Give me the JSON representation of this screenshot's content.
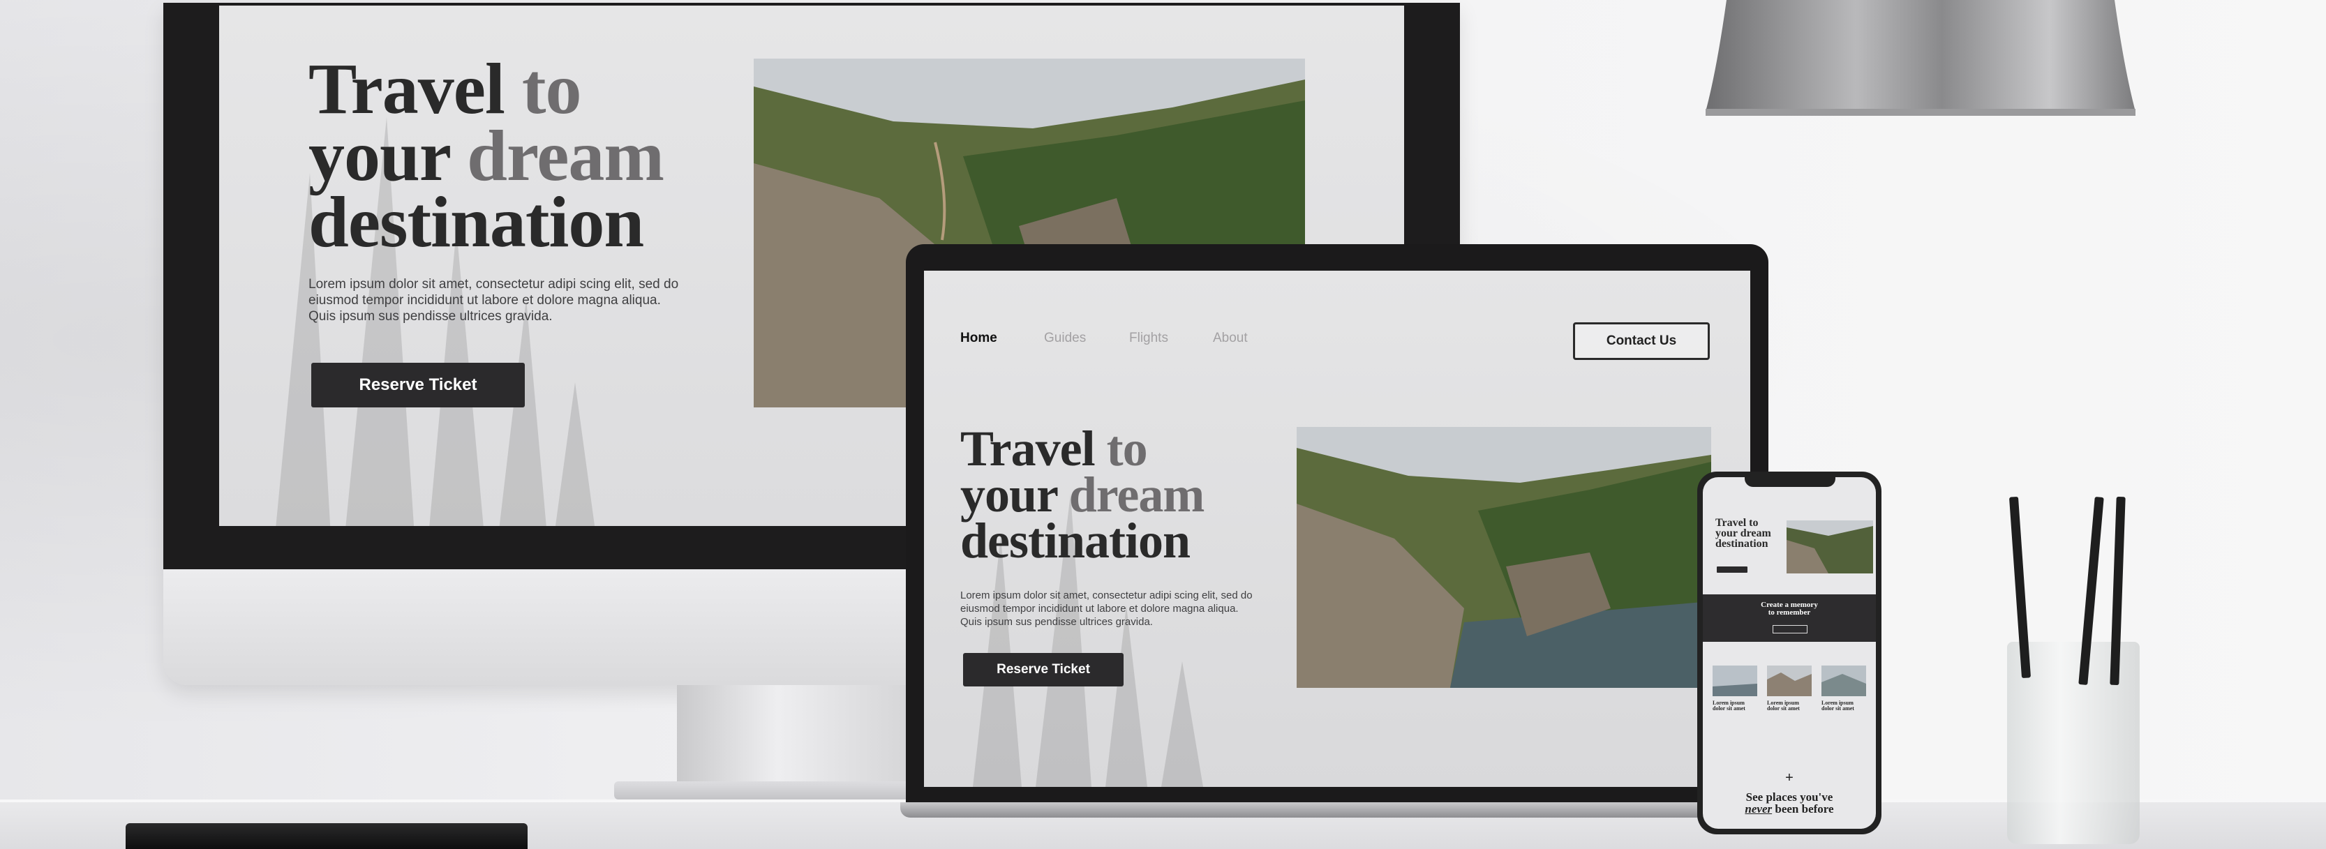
{
  "monitor": {
    "hero_title_line1a": "Travel",
    "hero_title_line1b": "to",
    "hero_title_line2a": "your",
    "hero_title_line2b": "dream",
    "hero_title_line3": "destination",
    "body_line1": "Lorem ipsum dolor sit amet, consectetur adipi scing elit, sed do",
    "body_line2": "eiusmod tempor incididunt ut labore et dolore magna aliqua.",
    "body_line3": "Quis ipsum sus pendisse ultrices gravida.",
    "cta_label": "Reserve Ticket"
  },
  "laptop": {
    "nav": [
      "Home",
      "Guides",
      "Flights",
      "About"
    ],
    "contact_label": "Contact Us",
    "hero_title_line1a": "Travel",
    "hero_title_line1b": "to",
    "hero_title_line2a": "your",
    "hero_title_line2b": "dream",
    "hero_title_line3": "destination",
    "body_line1": "Lorem ipsum dolor sit amet, consectetur adipi scing elit, sed do",
    "body_line2": "eiusmod tempor incididunt ut labore et dolore magna aliqua.",
    "body_line3": "Quis ipsum sus pendisse ultrices gravida.",
    "cta_label": "Reserve Ticket"
  },
  "phone": {
    "hero_title_line1": "Travel to",
    "hero_title_line2": "your dream",
    "hero_title_line3": "destination",
    "banner_line1": "Create a memory",
    "banner_line2": "to remember",
    "card_title_1": "Lorem ipsum",
    "card_title_2": "dolor sit amet",
    "plus_glyph": "+",
    "footer_line1": "See places you've",
    "footer_never": "never",
    "footer_line2_rest": "been before"
  },
  "colors": {
    "ink": "#2a2a2a",
    "muted_ink": "#6f6d6f",
    "button_dark": "#2b2a2c",
    "screen_bg": "#e2e2e4",
    "device_bezel": "#1d1c1d"
  },
  "icons": [
    "plus-icon"
  ]
}
